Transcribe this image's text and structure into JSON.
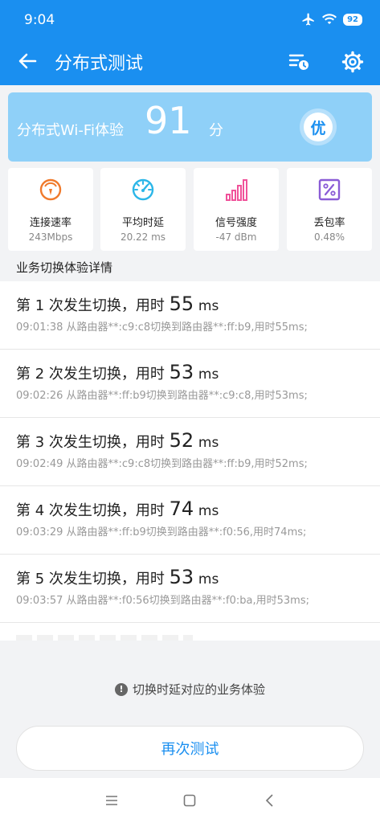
{
  "status_bar": {
    "time": "9:04",
    "battery": "92"
  },
  "app_bar": {
    "title": "分布式测试"
  },
  "score_card": {
    "label": "分布式Wi-Fi体验",
    "score": "91",
    "unit": "分",
    "grade": "优"
  },
  "metrics": [
    {
      "label": "连接速率",
      "value": "243Mbps",
      "icon": "speedometer-icon",
      "color": "#f07a2c"
    },
    {
      "label": "平均时延",
      "value": "20.22 ms",
      "icon": "gauge-icon",
      "color": "#2bb6e8"
    },
    {
      "label": "信号强度",
      "value": "-47 dBm",
      "icon": "signal-bars-icon",
      "color": "#f0529a"
    },
    {
      "label": "丢包率",
      "value": "0.48%",
      "icon": "percent-icon",
      "color": "#8a5cd6"
    }
  ],
  "section_title": "业务切换体验详情",
  "handoffs": [
    {
      "prefix": "第 1 次发生切换，用时",
      "ms_value": "55",
      "ms_unit": "ms",
      "detail": "09:01:38 从路由器**:c9:c8切换到路由器**:ff:b9,用时55ms;"
    },
    {
      "prefix": "第 2 次发生切换，用时",
      "ms_value": "53",
      "ms_unit": "ms",
      "detail": "09:02:26 从路由器**:ff:b9切换到路由器**:c9:c8,用时53ms;"
    },
    {
      "prefix": "第 3 次发生切换，用时",
      "ms_value": "52",
      "ms_unit": "ms",
      "detail": "09:02:49 从路由器**:c9:c8切换到路由器**:ff:b9,用时52ms;"
    },
    {
      "prefix": "第 4 次发生切换，用时",
      "ms_value": "74",
      "ms_unit": "ms",
      "detail": "09:03:29 从路由器**:ff:b9切换到路由器**:f0:56,用时74ms;"
    },
    {
      "prefix": "第 5 次发生切换，用时",
      "ms_value": "53",
      "ms_unit": "ms",
      "detail": "09:03:57 从路由器**:f0:56切换到路由器**:f0:ba,用时53ms;"
    }
  ],
  "note": "切换时延对应的业务体验",
  "retest_button": "再次测试",
  "colors": {
    "primary": "#1a8ff0",
    "score_bg": "#8fd0f8"
  }
}
